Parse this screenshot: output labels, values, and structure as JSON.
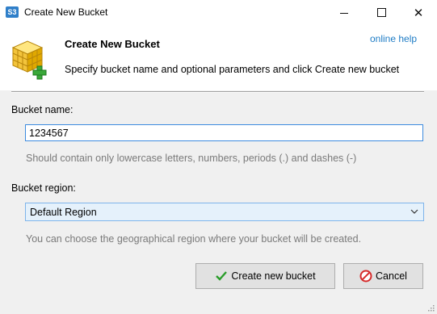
{
  "window": {
    "app_icon": "S3",
    "title": "Create New Bucket",
    "min_icon": "minimize-icon",
    "max_icon": "maximize-icon",
    "close_glyph": "✕"
  },
  "header": {
    "title": "Create New Bucket",
    "description": "Specify bucket name and optional parameters and click Create new bucket",
    "help_link": "online help",
    "icon": "bucket-add-icon"
  },
  "form": {
    "bucket_name_label": "Bucket name:",
    "bucket_name_value": "1234567",
    "bucket_name_hint": "Should contain only lowercase letters, numbers, periods (.) and dashes (-)",
    "region_label": "Bucket region:",
    "region_value": "Default Region",
    "region_hint": "You can choose the geographical region where your bucket will be created."
  },
  "buttons": {
    "create_label": "Create new bucket",
    "cancel_label": "Cancel"
  },
  "colors": {
    "link": "#1e7cc5",
    "input_border": "#3c8be0",
    "select_bg": "#e5f1fb"
  }
}
